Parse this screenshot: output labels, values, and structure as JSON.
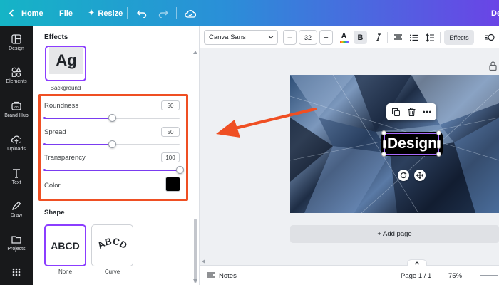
{
  "topbar": {
    "home_label": "Home",
    "file_label": "File",
    "resize_label": "Resize",
    "right_label": "De"
  },
  "rail": {
    "items": [
      {
        "label": "Design",
        "icon": "layout-icon"
      },
      {
        "label": "Elements",
        "icon": "shapes-icon"
      },
      {
        "label": "Brand Hub",
        "icon": "brand-icon"
      },
      {
        "label": "Uploads",
        "icon": "upload-icon"
      },
      {
        "label": "Text",
        "icon": "text-icon"
      },
      {
        "label": "Draw",
        "icon": "pen-icon"
      },
      {
        "label": "Projects",
        "icon": "folder-icon"
      },
      {
        "label": "Apps",
        "icon": "grid-icon"
      }
    ]
  },
  "panel": {
    "title": "Effects",
    "background_card_text": "Ag",
    "background_label": "Background",
    "sliders": [
      {
        "label": "Roundness",
        "value": "50",
        "fraction": 0.5
      },
      {
        "label": "Spread",
        "value": "50",
        "fraction": 0.5
      },
      {
        "label": "Transparency",
        "value": "100",
        "fraction": 1.0
      }
    ],
    "color_label": "Color",
    "color_value": "#000000",
    "shape_title": "Shape",
    "shapes": [
      {
        "text": "ABCD",
        "label": "None",
        "selected": true
      },
      {
        "text": "ABCD",
        "label": "Curve",
        "selected": false
      }
    ]
  },
  "toolbar": {
    "font": "Canva Sans",
    "size_minus": "–",
    "size": "32",
    "size_plus": "+",
    "color_glyph": "A",
    "bold_glyph": "B",
    "effects_label": "Effects",
    "brand_color": "#8b3dff"
  },
  "canvas": {
    "text_element": "Design",
    "add_page_label": "+ Add page"
  },
  "bottombar": {
    "notes_label": "Notes",
    "page_label": "Page 1 / 1",
    "zoom_label": "75%"
  },
  "annotation": {
    "highlight_color": "#ef4f23",
    "arrow_color": "#ef4f23"
  }
}
